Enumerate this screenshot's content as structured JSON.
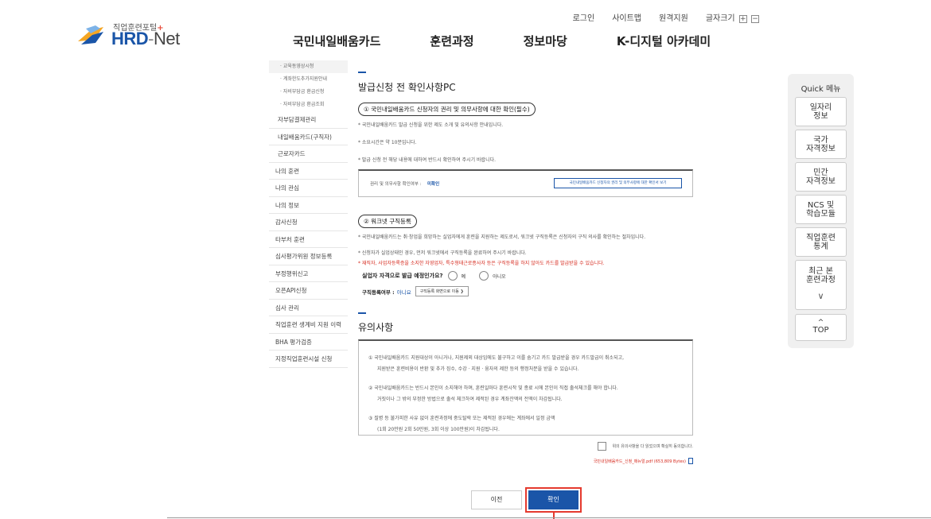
{
  "logo": {
    "subtitle": "직업훈련포털",
    "plus": "+",
    "hrd": "HRD",
    "dash": "-",
    "net": "Net"
  },
  "util": {
    "login": "로그인",
    "sitemap": "사이트맵",
    "remote": "원격지원",
    "font_size": "글자크기",
    "font_plus": "+",
    "font_minus": "−"
  },
  "gnb": [
    "국민내일배움카드",
    "훈련과정",
    "정보마당",
    "K-디지털 아카데미"
  ],
  "lnb": {
    "sub_items": [
      "· 교육동영상시청",
      "· 계좌한도추가지원안내",
      "· 자비부담금 환급신청",
      "· 자비부담금 환급조회"
    ],
    "items": [
      "자부담결제관리",
      "내일배움카드(구직자)",
      "근로자카드",
      "나의 훈련",
      "나의 관심",
      "나의 정보",
      "감사신청",
      "타부처 훈련",
      "심사평가위원 정보등록",
      "부정행위신고",
      "오픈API신청",
      "심사 관리",
      "직업훈련 생계비 지원 이력",
      "BHA 평가검증",
      "지정직업훈련시설 신청"
    ]
  },
  "content": {
    "title": "발급신청 전 확인사항PC",
    "sec1_label": "① 국민내일배움카드 신청자의 권리 및 의무사항에 대한 확인(필수)",
    "sec1_b1": "* 국민내일배움카드 발급 신청을 위한 제도 소개 및 유의사항 안내입니다.",
    "sec1_b2": "* 소요시간은 약 10분입니다.",
    "sec1_b3": "* 발급 신청 전 해당 내용에 대하여 반드시 확인하여 주시기 바랍니다.",
    "confirm_label": "권리 및 의무사항 확인여부 :",
    "confirm_status": "미확인",
    "confirm_button": "국민내일배움카드 신청자의 권리 및 의무사항에 대한 확인서 보기",
    "sec2_label": "② 워크넷 구직등록",
    "sec2_b1": "* 국민내일배움카드는 취·창업을 희망하는 실업자에게 훈련을 지원하는 제도로서, 워크넷 구직등록은 신청자의 구직 의사를 확인하는 절차입니다.",
    "sec2_b2": "* 신청자가 실업상태인 경우, 먼저 워크넷에서 구직등록을 완료하여 주시기 바랍니다.",
    "sec2_b3": "* 재직자, 사업자등록증을 소지한 자영업자, 특수형태근로종사자 등은 구직등록을 하지 않아도 카드를 발급받을 수 있습니다.",
    "q_text": "실업자 자격으로 발급 예정인가요?",
    "q_yes": "예",
    "q_no": "아니오",
    "job_label": "구직등록여부 :",
    "job_status": "아니요",
    "job_button": "구직등록 화면으로 이동 ❯",
    "notice_title": "유의사항",
    "n1a": "① 국민내일배움카드 지원대상이 아니거나, 지원제외 대상임에도 불구하고 이를 숨기고 카드 발급받을 경우 카드발급이 취소되고,",
    "n1b": "지원받은 훈련비용이 반환 및 추가 징수, 수강 · 지원 · 융자의 제한 등의 행정처분을 받을 수 있습니다.",
    "n2a": "② 국민내일배움카드는 반드시 본인이 소지해야 하며, 훈련일마다 훈련시작 및 종료 시에 본인이 직접 출석체크를 해야 합니다.",
    "n2b": "거짓이나 그 밖의 부정한 방법으로 출석 체크하여 제적된 경우 계좌잔액의 전액이 차감됩니다.",
    "n3a": "③ 질병 등 불가피한 사유 없이 훈련과정에 중도탈락 또는 제적된 경우에는 계좌에서 일정 금액",
    "n3b": "(1회 20만원 2회 50만원, 3회 이상 100만원)이 차감됩니다.",
    "agree_text": "위의 유의사항을 다 읽었으며 확실히 동의합니다.",
    "file_link": "국민내일배움카드_신청_매뉴얼.pdf (653,809 Bytes)"
  },
  "buttons": {
    "prev": "이전",
    "confirm": "확인"
  },
  "quick": {
    "title": "Quick 메뉴",
    "items": [
      {
        "l1": "일자리",
        "l2": "정보"
      },
      {
        "l1": "국가",
        "l2": "자격정보"
      },
      {
        "l1": "민간",
        "l2": "자격정보"
      },
      {
        "l1": "NCS 및",
        "l2": "학습모듈"
      },
      {
        "l1": "직업훈련",
        "l2": "통계"
      },
      {
        "l1": "최근 본",
        "l2": "훈련과정"
      }
    ],
    "top": "TOP",
    "top_arrow": "^",
    "down_arrow": "∨"
  },
  "colors": {
    "brand_blue": "#1a55a8",
    "highlight_red": "#d62b1f"
  }
}
